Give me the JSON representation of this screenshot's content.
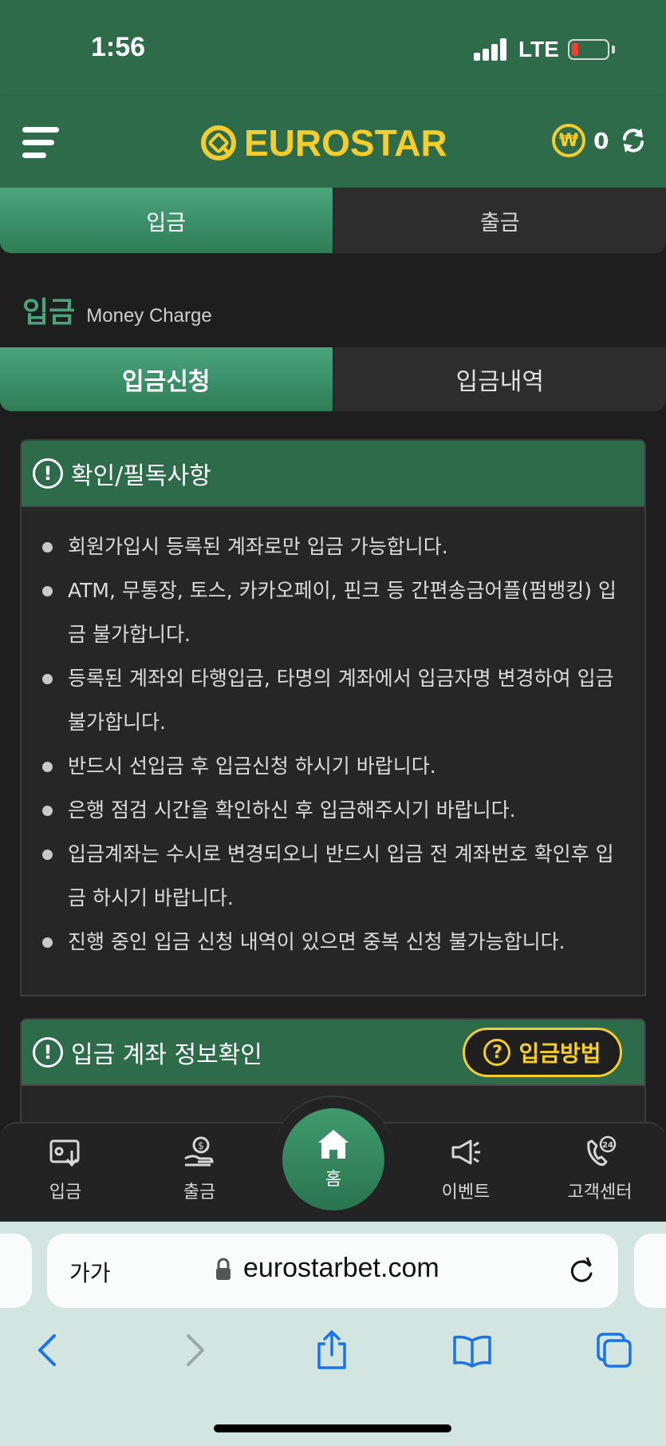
{
  "status_bar": {
    "time": "1:56",
    "network": "LTE"
  },
  "header": {
    "logo_euro": "EURO",
    "logo_star": "STAR",
    "currency_symbol": "₩",
    "balance": "0"
  },
  "main_tabs": [
    {
      "label": "입금",
      "active": true
    },
    {
      "label": "출금",
      "active": false
    }
  ],
  "section": {
    "title": "입금",
    "subtitle": "Money Charge"
  },
  "sub_tabs": [
    {
      "label": "입금신청",
      "active": true
    },
    {
      "label": "입금내역",
      "active": false
    }
  ],
  "notice": {
    "title": "확인/필독사항",
    "items": [
      "회원가입시 등록된 계좌로만 입금 가능합니다.",
      "ATM, 무통장, 토스, 카카오페이, 핀크 등 간편송금어플(펌뱅킹) 입금 불가합니다.",
      "등록된 계좌외 타행입금, 타명의 계좌에서 입금자명 변경하여 입금 불가합니다.",
      "반드시 선입금 후 입금신청 하시기 바랍니다.",
      "은행 점검 시간을 확인하신 후 입금해주시기 바랍니다.",
      "입금계좌는 수시로 변경되오니 반드시 입금 전 계좌번호 확인후 입금 하시기 바랍니다.",
      "진행 중인 입금 신청 내역이 있으면 중복 신청 불가능합니다."
    ]
  },
  "account_info": {
    "title": "입금 계좌 정보확인",
    "method_button": "입금방법"
  },
  "bottom_nav": {
    "deposit": "입금",
    "withdraw": "출금",
    "home": "홈",
    "events": "이벤트",
    "support": "고객센터"
  },
  "browser": {
    "text_size_label": "가가",
    "url": "eurostarbet.com"
  },
  "colors": {
    "brand_green": "#2e6b4a",
    "accent_green": "#4aa57c",
    "gold": "#f5cd2f",
    "background": "#1e1e1e"
  }
}
